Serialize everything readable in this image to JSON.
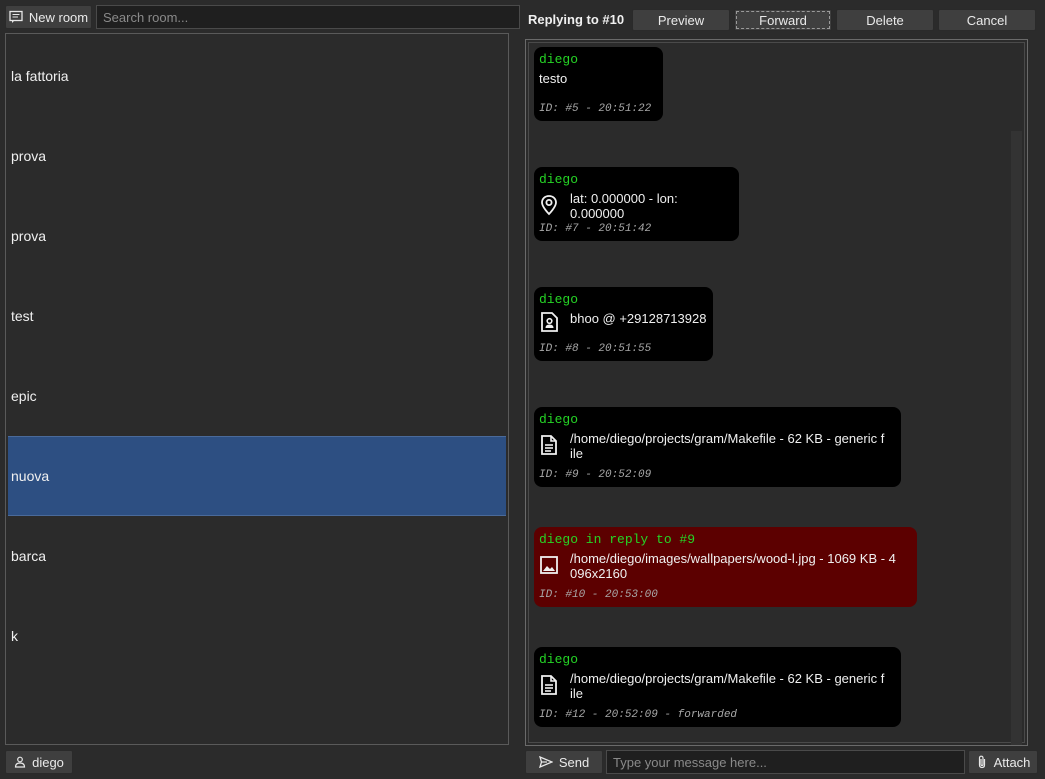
{
  "left": {
    "new_room_label": "New room",
    "search_placeholder": "Search room...",
    "rooms": [
      {
        "name": "la fattoria"
      },
      {
        "name": "prova"
      },
      {
        "name": "prova"
      },
      {
        "name": "test"
      },
      {
        "name": "epic"
      },
      {
        "name": "nuova",
        "selected": true
      },
      {
        "name": "barca"
      },
      {
        "name": "k"
      }
    ],
    "user_label": "diego"
  },
  "header": {
    "replying_label": "Replying to #10",
    "preview_label": "Preview",
    "forward_label": "Forward",
    "delete_label": "Delete",
    "cancel_label": "Cancel"
  },
  "messages": [
    {
      "author": "diego",
      "icon": "none",
      "text": "testo",
      "meta": "ID: #5 - 20:51:22"
    },
    {
      "author": "diego",
      "icon": "location-pin-icon",
      "text": "lat: 0.000000 - lon: 0.000000",
      "meta": "ID: #7 - 20:51:42"
    },
    {
      "author": "diego",
      "icon": "contact-icon",
      "text": "bhoo @ +29128713928",
      "meta": "ID: #8 - 20:51:55"
    },
    {
      "author": "diego",
      "icon": "document-icon",
      "text_line1": "/home/diego/projects/gram/Makefile - 62 KB - generic f",
      "text_line2": "ile",
      "meta": "ID: #9 - 20:52:09"
    },
    {
      "author": "diego in reply to #9",
      "icon": "image-icon",
      "text_line1": "/home/diego/images/wallpapers/wood-l.jpg - 1069 KB - 4",
      "text_line2": "096x2160",
      "meta": "ID: #10 - 20:53:00",
      "reply_color": "#5c0000"
    },
    {
      "author": "diego",
      "icon": "document-icon",
      "text_line1": "/home/diego/projects/gram/Makefile - 62 KB - generic f",
      "text_line2": "ile",
      "meta": "ID: #12 - 20:52:09 - forwarded"
    }
  ],
  "footer": {
    "send_label": "Send",
    "message_placeholder": "Type your message here...",
    "attach_label": "Attach"
  },
  "colors": {
    "background": "#2b2b2b",
    "selected_room": "#2d4f82",
    "author_green": "#25d425",
    "message_bg": "#000000",
    "reply_bg": "#5c0000"
  }
}
